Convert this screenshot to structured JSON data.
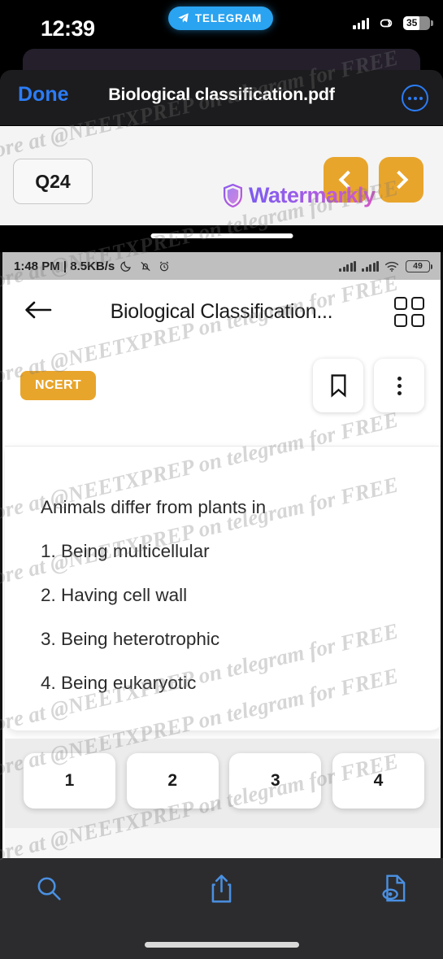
{
  "ios_status": {
    "time": "12:39",
    "telegram_badge": "TELEGRAM",
    "telegram_icon": "paper-plane-icon",
    "signal_icon": "cellular-signal-icon",
    "link_icon": "link-loop-icon",
    "battery_level": "35"
  },
  "ios_nav": {
    "done_label": "Done",
    "document_title": "Biological classification.pdf",
    "more_icon": "ellipsis-circle-icon"
  },
  "pdf_page": {
    "question_label": "Q24",
    "prev_icon": "chevron-left-icon",
    "next_icon": "chevron-right-icon",
    "watermarkly_brand": "Watermarkly",
    "watermarkly_shield_icon": "shield-icon"
  },
  "android_status": {
    "time_and_speed": "1:48 PM | 8.5KB/s",
    "moon_icon": "crescent-moon-icon",
    "mute_icon": "bell-muted-icon",
    "alarm_icon": "alarm-clock-icon",
    "signal1_icon": "cellular-signal-icon",
    "signal2_icon": "cellular-signal-icon",
    "wifi_icon": "wifi-icon",
    "battery_level": "49"
  },
  "android_appbar": {
    "back_icon": "arrow-left-icon",
    "title": "Biological Classification...",
    "grid_icon": "grid-view-icon"
  },
  "android_toolrow": {
    "source_badge": "NCERT",
    "bookmark_icon": "bookmark-icon",
    "kebab_icon": "more-vertical-icon"
  },
  "question": {
    "stem": "Animals differ from plants in",
    "options": [
      "1. Being multicellular",
      "2. Having cell wall",
      "3. Being heterotrophic",
      "4. Being eukaryotic"
    ]
  },
  "answer_buttons": [
    "1",
    "2",
    "3",
    "4"
  ],
  "ios_toolbar": {
    "search_icon": "search-icon",
    "share_icon": "share-upload-icon",
    "markup_icon": "document-preview-icon"
  },
  "watermark": {
    "text": "More at @NEETXPREP on telegram for FREE"
  },
  "colors": {
    "accent_blue": "#2b7cf6",
    "orange": "#e8a52c",
    "telegram_blue": "#2aa3f0",
    "toolbar_blue": "#4a90e2"
  }
}
